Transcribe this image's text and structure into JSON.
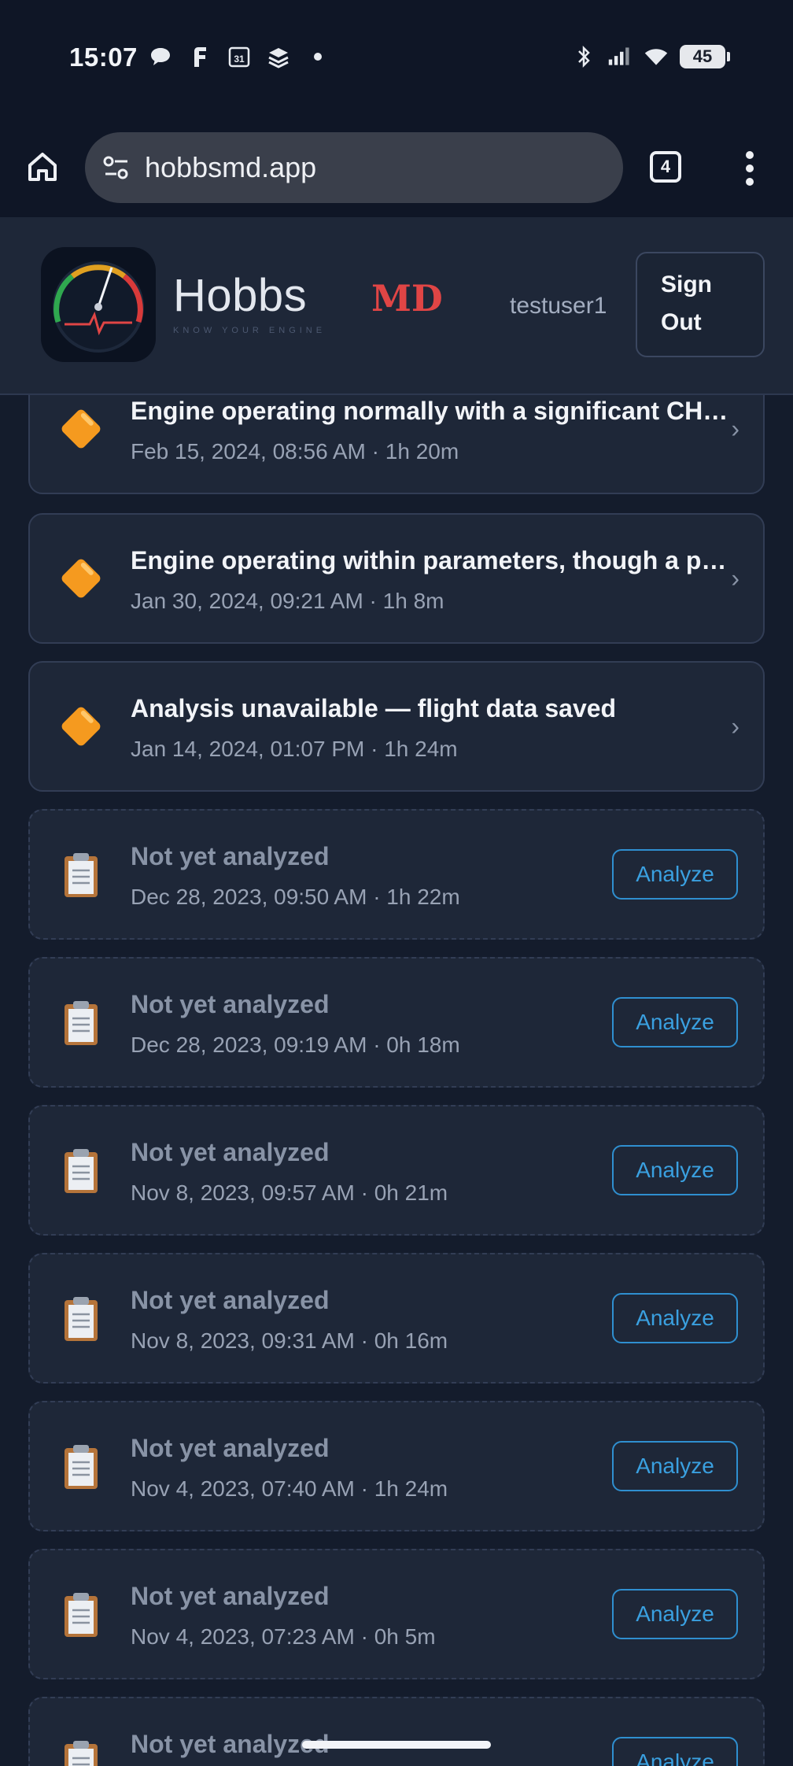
{
  "status_bar": {
    "time": "15:07",
    "left_icons": [
      "chat-bubble-icon",
      "f-app-icon",
      "calendar-icon",
      "layers-icon",
      "dot-icon"
    ],
    "right_icons": [
      "bluetooth-icon",
      "signal-icon",
      "wifi-icon"
    ],
    "battery": "45"
  },
  "browser": {
    "url": "hobbsmd.app",
    "tab_count": "4"
  },
  "header": {
    "brand_name": "Hobbs",
    "brand_tagline": "KNOW YOUR ENGINE",
    "brand_suffix": "MD",
    "username": "testuser1",
    "sign_out_label": "Sign Out"
  },
  "flights": [
    {
      "status": "analyzed",
      "icon": "orange-diamond-icon",
      "title": "Engine operating normally with a significant CH…",
      "subtitle": "Feb 15, 2024, 08:56 AM · 1h 20m",
      "chevron": "›"
    },
    {
      "status": "analyzed",
      "icon": "orange-diamond-icon",
      "title": "Engine operating within parameters, though a p…",
      "subtitle": "Jan 30, 2024, 09:21 AM · 1h 8m",
      "chevron": "›"
    },
    {
      "status": "analyzed",
      "icon": "orange-diamond-icon",
      "title": "Analysis unavailable — flight data saved",
      "subtitle": "Jan 14, 2024, 01:07 PM · 1h 24m",
      "chevron": "›"
    },
    {
      "status": "pending",
      "icon": "clipboard-icon",
      "title": "Not yet analyzed",
      "subtitle": "Dec 28, 2023, 09:50 AM · 1h 22m",
      "action": "Analyze"
    },
    {
      "status": "pending",
      "icon": "clipboard-icon",
      "title": "Not yet analyzed",
      "subtitle": "Dec 28, 2023, 09:19 AM · 0h 18m",
      "action": "Analyze"
    },
    {
      "status": "pending",
      "icon": "clipboard-icon",
      "title": "Not yet analyzed",
      "subtitle": "Nov 8, 2023, 09:57 AM · 0h 21m",
      "action": "Analyze"
    },
    {
      "status": "pending",
      "icon": "clipboard-icon",
      "title": "Not yet analyzed",
      "subtitle": "Nov 8, 2023, 09:31 AM · 0h 16m",
      "action": "Analyze"
    },
    {
      "status": "pending",
      "icon": "clipboard-icon",
      "title": "Not yet analyzed",
      "subtitle": "Nov 4, 2023, 07:40 AM · 1h 24m",
      "action": "Analyze"
    },
    {
      "status": "pending",
      "icon": "clipboard-icon",
      "title": "Not yet analyzed",
      "subtitle": "Nov 4, 2023, 07:23 AM · 0h 5m",
      "action": "Analyze"
    },
    {
      "status": "pending",
      "icon": "clipboard-icon",
      "title": "Not yet analyzed",
      "subtitle": "",
      "action": "Analyze"
    }
  ],
  "colors": {
    "background": "#141c2c",
    "card": "#1e2738",
    "accent_blue": "#3aa0e0",
    "brand_red": "#e04545",
    "warning_orange": "#f59a1f"
  }
}
